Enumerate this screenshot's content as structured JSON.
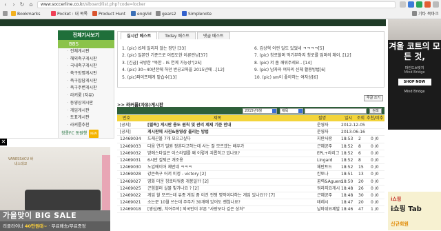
{
  "browser": {
    "url_domain": "www.soccerline.co.kr",
    "url_path": "/slboard/list.php?code=locker",
    "bookmarks": [
      {
        "label": "Bookmarks",
        "icon": "star-icon",
        "color": "#f2b01e"
      },
      {
        "label": "Pocket : 내 목록",
        "icon": "pocket-icon",
        "color": "#ef4056"
      },
      {
        "label": "Product Hunt",
        "icon": "product-hunt-icon",
        "color": "#da552f"
      },
      {
        "label": "engVid",
        "icon": "engvid-icon",
        "color": "#3b6fb6"
      },
      {
        "label": "gears2",
        "icon": "folder-icon",
        "color": "#888888"
      },
      {
        "label": "Simplenote",
        "icon": "simplenote-icon",
        "color": "#3361cc"
      }
    ],
    "other_bookmarks": "기타 북마크"
  },
  "sidebar": {
    "header": "전체기사보기",
    "section": "BBS",
    "items": [
      "전체게시판",
      "해외축구게시판",
      "국내축구게시판",
      "축구방명게시판",
      "축구잡담게시판",
      "축구주변게시판",
      "라커룸 (자유)",
      "동영상게시판",
      "게임게시판",
      "토표게시판",
      "라커룸추천"
    ],
    "last_item": "칭롱FC 동원행",
    "last_badge": "NEW"
  },
  "best": {
    "tabs": [
      "실시간 베스트",
      "Today 베스트",
      "댓글 베스트"
    ],
    "left": [
      "1. (pic) IS에 일리지 않는 장단 [33]",
      "2. (pic) 일본인 기준으로 어렵도한 이른런닝[37]",
      "3. [긴급] 국방한 \"북한 - IS 연계 가능성\"[25]",
      "4. (pic) 30~40년전에 하던 반공교육을 2015년에 ..[12]",
      "5. (pic)파이프에게 맡습수[13]"
    ],
    "right": [
      "6. 김상혁 이런 일도 있었네 ㅋㅋㅋㅋ[5]",
      "7. (pic) 칭로할머 먹기부하지 칭로를 엄마의 체이..[12]",
      "8. (pic) 저 좀 깨워주세요.. [14]",
      "9. (pic) 남자와 여자의 신체 활용방법[6]",
      "10. (pic) sm이 좋아하는 여자상[6]"
    ]
  },
  "board": {
    "more_button": "루글 쓰기",
    "title": ">> 라커룸(자유)게시판",
    "filter_month": "2015년9월",
    "filter_field": "제목",
    "search_button": "검색",
    "columns": [
      "번호",
      "제목",
      "필명",
      "일시",
      "조회",
      "추천/비추"
    ],
    "rows": [
      {
        "no": "[공지]",
        "title": "[필독] 게시판 용도 원칙 및 관리 제재 기준 안내",
        "author": "운영자",
        "time": "2012-12-05",
        "views": "",
        "votes": "",
        "notice": true
      },
      {
        "no": "[공지]",
        "title": "게시판에 사진&동영상 올리는 방법",
        "author": "운영자",
        "time": "2013-06-16",
        "views": "",
        "votes": "",
        "notice": true
      },
      {
        "no": "12469034",
        "title": "드래곤볼 7개 모으고싶다",
        "author": "지란사랑",
        "time": "18:53",
        "views": "2",
        "votes": "0 /0",
        "notice": false
      },
      {
        "no": "12469033",
        "title": "다음 연기 밀원 장흔다고하는데 사는 잘 모르겠는 배우가",
        "author": "근혜공주",
        "time": "18:52",
        "views": "8",
        "votes": "0 /0",
        "notice": false
      },
      {
        "no": "12469032",
        "title": "밤에스타일은 이스라엘를 왜 이렇게 괴롭히고 있나요?",
        "author": "EPL+라리그",
        "time": "18:52",
        "views": "6",
        "votes": "0 /0",
        "notice": false
      },
      {
        "no": "12469031",
        "title": "6시반 칼퇴근 개조용",
        "author": "Lingard",
        "time": "18:52",
        "views": "8",
        "votes": "0 /0",
        "notice": false
      },
      {
        "no": "12469030",
        "title": "노입에이어 체반네 ㅋㅋㅋ",
        "author": "체반트드",
        "time": "18:52",
        "views": "15",
        "votes": "0 /0",
        "notice": false
      },
      {
        "no": "12469028",
        "title": "강은축구 어저 미정 - victory [2]",
        "author": "칸토나",
        "time": "18:51",
        "views": "13",
        "votes": "0 /0",
        "notice": false
      },
      {
        "no": "12469027",
        "title": "영화 더운 칭로타워중 개봉일?? [2]",
        "author": "꿈력&Aguero",
        "time": "18:50",
        "views": "20",
        "votes": "0 /0",
        "notice": false
      },
      {
        "no": "12469025",
        "title": "곤힘블러 실물 빛가나요 ? [2]",
        "author": "워라지요게시",
        "time": "18:48",
        "views": "26",
        "votes": "0 /0",
        "notice": false
      },
      {
        "no": "12469022",
        "title": "게임 할 모르는데 유종 게임 좀 이건 전쟁 명작이다하는 게임 있나요?? [7]",
        "author": "근혜공주",
        "time": "18:48",
        "views": "30",
        "votes": "0 /0",
        "notice": false
      },
      {
        "no": "12469021",
        "title": "소는문 10월 쓰는데 주주가 30개에 있어도 괜찮나요?",
        "author": "데레시",
        "time": "18:47",
        "views": "20",
        "votes": "0 /0",
        "notice": false
      },
      {
        "no": "12469018",
        "title": "[영상/펌, 치어주의] 외국인이 부른 \"사랑보다 깊은 상처\"",
        "author": "날바위요제발",
        "time": "18:46",
        "views": "47",
        "votes": "1 /0",
        "notice": false
      }
    ]
  },
  "ad_right": {
    "headline": "겨울 코트의 모든 것,",
    "sub1": "마인드브릿지",
    "sub2": "Mind Bridge",
    "cta": "SHOP NOW",
    "brand": "Mind Bridge",
    "bottom_tag": "i쇼핑",
    "bottom_title": "i쇼핑 Tab",
    "bottom_sub": "신규회원"
  },
  "ad_left": {
    "close": "✕",
    "brand": "VANESSACU 바네스데코",
    "headline": "가을맞이 BIG SALE",
    "sub_prefix": "리클라이너",
    "sub_price": "40만원대~",
    "sub_suffix": "무료배송/무료증정"
  },
  "colors": {
    "board_green": "#2f5f3a",
    "accent_yellow": "#f3d43a",
    "sidebar_green": "#1f6f3a",
    "bbs_lime": "#8bc34a"
  }
}
